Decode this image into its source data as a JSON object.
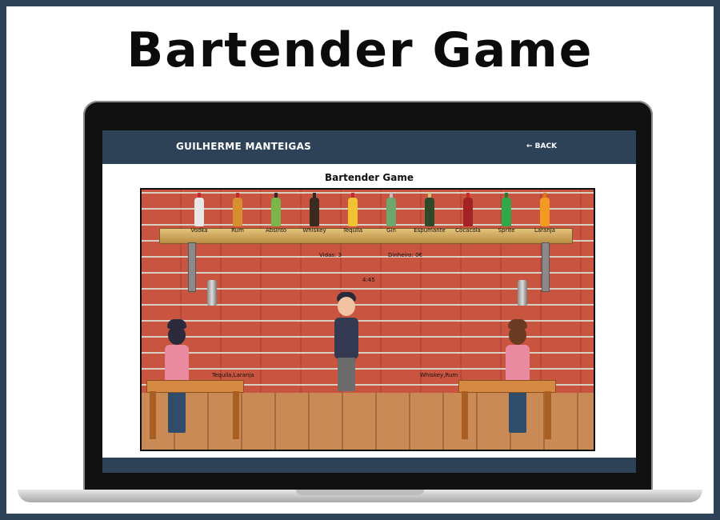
{
  "hero": {
    "title": "Bartender Game"
  },
  "header": {
    "brand": "GUILHERME MANTEIGAS",
    "back_label": "← BACK"
  },
  "game": {
    "title": "Bartender Game",
    "bottles": [
      {
        "label": "Vodka",
        "color": "#e7e7e7",
        "cap": "#c9272e"
      },
      {
        "label": "Rum",
        "color": "#d6902f",
        "cap": "#c9272e"
      },
      {
        "label": "Absinto",
        "color": "#7bb64a",
        "cap": "#2b2b2b"
      },
      {
        "label": "Whiskey",
        "color": "#3a2a1f",
        "cap": "#2b2b2b"
      },
      {
        "label": "Tequila",
        "color": "#f1c232",
        "cap": "#c9272e"
      },
      {
        "label": "Gin",
        "color": "#6aa86e",
        "cap": "#bdbdbd"
      },
      {
        "label": "Espumante",
        "color": "#2f4a28",
        "cap": "#d4c06a"
      },
      {
        "label": "Cocacola",
        "color": "#a32223",
        "cap": "#c9272e"
      },
      {
        "label": "Sprite",
        "color": "#2fa84a",
        "cap": "#1f7a33"
      },
      {
        "label": "Laranja",
        "color": "#f39a22",
        "cap": "#e07a10"
      }
    ],
    "hud": {
      "vidas_label": "Vidas:",
      "vidas_value": "3",
      "dinheiro_label": "Dinheiro:",
      "dinheiro_value": "0€",
      "timer": "4:45"
    },
    "orders": {
      "left": "Tequila,Laranja",
      "right": "Whiskey,Rum"
    }
  }
}
